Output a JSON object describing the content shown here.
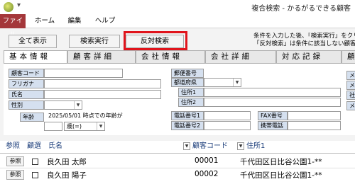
{
  "window": {
    "title": "複合検索 - かるがるできる顧客"
  },
  "ribbon": {
    "tabs": [
      "ファイル",
      "ホーム",
      "編集",
      "ヘルプ"
    ]
  },
  "toolbar": {
    "show_all": "全て表示",
    "search": "検索実行",
    "reverse_search": "反対検索",
    "info_lines": [
      "条件を入力した後、「検索実行」をクリ",
      "「反対検索」は条件に該当しない顧客"
    ]
  },
  "form_tabs": [
    "基本情報",
    "顧客詳細",
    "会社情報",
    "会社詳細",
    "対応記録",
    "顧"
  ],
  "form": {
    "customer_code_label": "顧客コード",
    "furigana_label": "フリガナ",
    "name_label": "氏名",
    "gender_label": "性別",
    "age_label": "年齢",
    "age_date": "2025/05/01",
    "age_note": "時点での年齢が",
    "age_unit": "歳(=)",
    "postal_label": "郵便番号",
    "prefecture_label": "都道府県",
    "address1_label": "住所1",
    "address2_label": "住所2",
    "phone1_label": "電話番号1",
    "phone2_label": "電話番号2",
    "fax_label": "FAX番号",
    "mobile_label": "携帯電話",
    "right_clip_labels": [
      "メ",
      "メ",
      "社",
      "メ"
    ]
  },
  "results": {
    "headers": {
      "ref": "参照",
      "select": "顧選",
      "name": "氏名",
      "code": "顧客コード",
      "address": "住所1"
    },
    "rows": [
      {
        "button": "参照",
        "name": "良久田 太郎",
        "code": "00001",
        "address": "千代田区日比谷公園1-**"
      },
      {
        "button": "参照",
        "name": "良久田 陽子",
        "code": "00002",
        "address": "千代田区日比谷公園1-**"
      }
    ]
  }
}
